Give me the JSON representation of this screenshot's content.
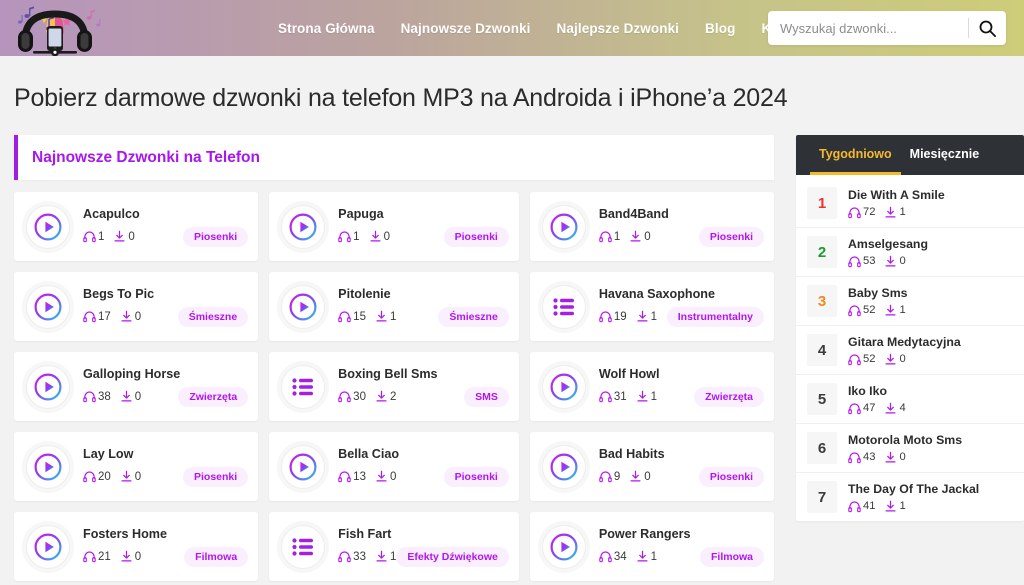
{
  "header": {
    "logo_name": "headphones-music-logo",
    "nav": [
      {
        "label": "Strona Główna",
        "name": "nav-strona-glowna",
        "caret": ""
      },
      {
        "label": "Najnowsze Dzwonki",
        "name": "nav-najnowsze-dzwonki",
        "caret": ""
      },
      {
        "label": "Najlepsze Dzwonki",
        "name": "nav-najlepsze-dzwonki",
        "caret": ""
      },
      {
        "label": "Blog",
        "name": "nav-blog",
        "caret": ""
      },
      {
        "label": "Kategoria",
        "name": "nav-kategoria",
        "caret": "⌄"
      }
    ],
    "search": {
      "placeholder": "Wyszukaj dzwonki...",
      "value": "",
      "button_icon": "search-icon"
    },
    "gradient_from": "#b694bd",
    "gradient_to": "#cdcd79"
  },
  "page": {
    "title": "Pobierz darmowe dzwonki na telefon MP3 na Androida i iPhone’a 2024"
  },
  "section": {
    "heading": "Najnowsze Dzwonki na Telefon",
    "accent": "#a916ef"
  },
  "cards": [
    {
      "title": "Acapulco",
      "plays": "1",
      "downloads": "0",
      "tag": "Piosenki",
      "icon": "play-icon"
    },
    {
      "title": "Papuga",
      "plays": "1",
      "downloads": "0",
      "tag": "Piosenki",
      "icon": "play-icon"
    },
    {
      "title": "Band4Band",
      "plays": "1",
      "downloads": "0",
      "tag": "Piosenki",
      "icon": "play-icon"
    },
    {
      "title": "Begs To Pic",
      "plays": "17",
      "downloads": "0",
      "tag": "Śmieszne",
      "icon": "play-icon"
    },
    {
      "title": "Pitolenie",
      "plays": "15",
      "downloads": "1",
      "tag": "Śmieszne",
      "icon": "play-icon"
    },
    {
      "title": "Havana Saxophone",
      "plays": "19",
      "downloads": "1",
      "tag": "Instrumentalny",
      "icon": "playlist-icon"
    },
    {
      "title": "Galloping Horse",
      "plays": "38",
      "downloads": "0",
      "tag": "Zwierzęta",
      "icon": "play-icon"
    },
    {
      "title": "Boxing Bell Sms",
      "plays": "30",
      "downloads": "2",
      "tag": "SMS",
      "icon": "playlist-icon"
    },
    {
      "title": "Wolf Howl",
      "plays": "31",
      "downloads": "1",
      "tag": "Zwierzęta",
      "icon": "play-icon"
    },
    {
      "title": "Lay Low",
      "plays": "20",
      "downloads": "0",
      "tag": "Piosenki",
      "icon": "play-icon"
    },
    {
      "title": "Bella Ciao",
      "plays": "13",
      "downloads": "0",
      "tag": "Piosenki",
      "icon": "play-icon"
    },
    {
      "title": "Bad Habits",
      "plays": "9",
      "downloads": "0",
      "tag": "Piosenki",
      "icon": "play-icon"
    },
    {
      "title": "Fosters Home",
      "plays": "21",
      "downloads": "0",
      "tag": "Filmowa",
      "icon": "play-icon"
    },
    {
      "title": "Fish Fart",
      "plays": "33",
      "downloads": "1",
      "tag": "Efekty Dźwiękowe",
      "icon": "playlist-icon"
    },
    {
      "title": "Power Rangers",
      "plays": "34",
      "downloads": "1",
      "tag": "Filmowa",
      "icon": "play-icon"
    }
  ],
  "sidebar": {
    "tabs": [
      {
        "label": "Tygodniowo",
        "name": "tab-tygodniowo",
        "active": true
      },
      {
        "label": "Miesięcznie",
        "name": "tab-miesiecznie",
        "active": false
      }
    ],
    "ranking": [
      {
        "rank": "1",
        "title": "Die With A Smile",
        "plays": "72",
        "downloads": "1",
        "color_class": "c1"
      },
      {
        "rank": "2",
        "title": "Amselgesang",
        "plays": "53",
        "downloads": "0",
        "color_class": "c2"
      },
      {
        "rank": "3",
        "title": "Baby Sms",
        "plays": "52",
        "downloads": "1",
        "color_class": "c3"
      },
      {
        "rank": "4",
        "title": "Gitara Medytacyjna",
        "plays": "52",
        "downloads": "0",
        "color_class": ""
      },
      {
        "rank": "5",
        "title": "Iko Iko",
        "plays": "47",
        "downloads": "4",
        "color_class": ""
      },
      {
        "rank": "6",
        "title": "Motorola Moto Sms",
        "plays": "43",
        "downloads": "0",
        "color_class": ""
      },
      {
        "rank": "7",
        "title": "The Day Of The Jackal",
        "plays": "41",
        "downloads": "1",
        "color_class": ""
      }
    ]
  }
}
